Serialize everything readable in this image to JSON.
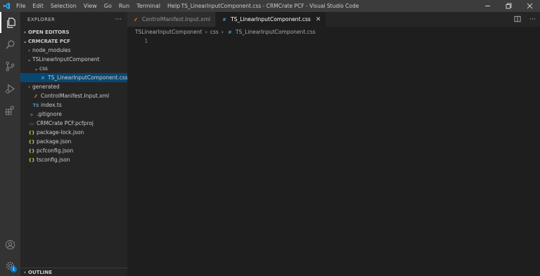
{
  "window": {
    "title": "TS_LinearInputComponent.css - CRMCrate PCF - Visual Studio Code",
    "menu": [
      "File",
      "Edit",
      "Selection",
      "View",
      "Go",
      "Run",
      "Terminal",
      "Help"
    ]
  },
  "activity_bar": {
    "items": [
      "explorer-icon",
      "search-icon",
      "source-control-icon",
      "run-debug-icon",
      "extensions-icon"
    ],
    "bottom": [
      "account-icon",
      "settings-gear-icon"
    ],
    "badge": "1"
  },
  "sidebar": {
    "title": "EXPLORER",
    "more": "···",
    "open_editors": "OPEN EDITORS",
    "workspace": "CRMCRATE PCF",
    "tree": [
      {
        "label": "node_modules",
        "twistie": "›",
        "icon": "",
        "icon_color": ""
      },
      {
        "label": "TSLinearInputComponent",
        "twistie": "⌄",
        "icon": "",
        "icon_color": ""
      },
      {
        "label": "css",
        "twistie": "⌄",
        "icon": "",
        "icon_color": ""
      },
      {
        "label": "TS_LinearInputComponent.css",
        "twistie": "",
        "icon": "#",
        "icon_color": "#519aba"
      },
      {
        "label": "generated",
        "twistie": "›",
        "icon": "",
        "icon_color": ""
      },
      {
        "label": "ControlManifest.Input.xml",
        "twistie": "",
        "icon": "⁄⁄",
        "icon_color": "#e37933"
      },
      {
        "label": "index.ts",
        "twistie": "",
        "icon": "TS",
        "icon_color": "#519aba"
      },
      {
        "label": ".gitignore",
        "twistie": "",
        "icon": "◆",
        "icon_color": "#41535b"
      },
      {
        "label": "CRMCrate PCF.pcfproj",
        "twistie": "",
        "icon": "▭",
        "icon_color": "#6d8086"
      },
      {
        "label": "package-lock.json",
        "twistie": "",
        "icon": "{}",
        "icon_color": "#cbcb41"
      },
      {
        "label": "package.json",
        "twistie": "",
        "icon": "{}",
        "icon_color": "#cbcb41"
      },
      {
        "label": "pcfconfig.json",
        "twistie": "",
        "icon": "{}",
        "icon_color": "#cbcb41"
      },
      {
        "label": "tsconfig.json",
        "twistie": "",
        "icon": "{}",
        "icon_color": "#cbcb41"
      }
    ],
    "outline": "OUTLINE"
  },
  "editor": {
    "tabs": [
      {
        "label": "ControlManifest.Input.xml",
        "icon": "⁄⁄",
        "icon_color": "#e37933",
        "active": false
      },
      {
        "label": "TS_LinearInputComponent.css",
        "icon": "#",
        "icon_color": "#519aba",
        "active": true
      }
    ],
    "close_glyph": "✕",
    "breadcrumb": [
      "TSLinearInputComponent",
      "css",
      "TS_LinearInputComponent.css"
    ],
    "breadcrumb_sep": "›",
    "line_numbers": [
      "1"
    ]
  },
  "colors": {
    "accent": "#007acc",
    "selection": "#094771",
    "titlebar": "#3c3c3c",
    "activity_bar": "#333333",
    "sidebar": "#252526",
    "editor": "#1e1e1e"
  }
}
